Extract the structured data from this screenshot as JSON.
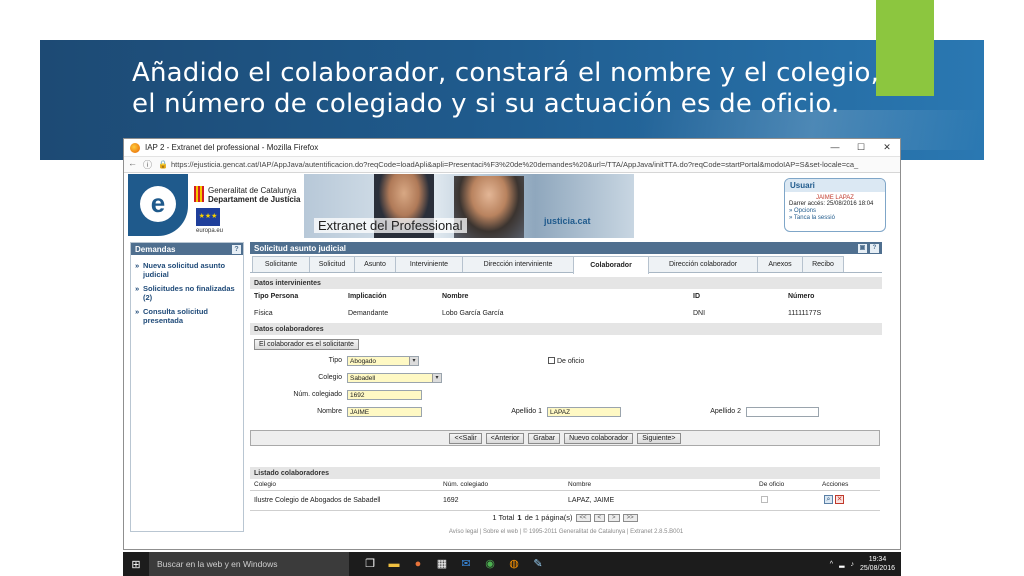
{
  "slide": {
    "title_line1": "Añadido el colaborador, constará el nombre y el colegio,",
    "title_line2": "el número de colegiado y si su actuación es de oficio.",
    "band_color": "#1f5a8c",
    "accent_color": "#8cc63f"
  },
  "browser": {
    "window_title": "IAP 2 - Extranet del professional - Mozilla Firefox",
    "url": "https://ejusticia.gencat.cat/IAP/AppJava/autentificacion.do?reqCode=loadApli&apli=Presentaci%F3%20de%20demandes%20&url=/TTA/AppJava/initTTA.do?reqCode=startPortal&modoIAP=S&set-locale=ca_",
    "controls": [
      "—",
      "☐",
      "✕"
    ]
  },
  "header": {
    "gencat_line1": "Generalitat de Catalunya",
    "gencat_line2": "Departament de Justícia",
    "eu_label": "europa.eu",
    "extranet_title": "Extranet del Professional",
    "justicia_logo": "justicia.cat",
    "user_box": {
      "title": "Usuari",
      "name": "JAIME LAPAZ",
      "last_access": "Darrer accés: 25/08/2016 18:04",
      "options": "» Opcions",
      "logout": "» Tanca la sessió"
    }
  },
  "left_panel": {
    "title": "Demandas",
    "items": [
      "Nueva solicitud asunto judicial",
      "Solicitudes no finalizadas (2)",
      "Consulta solicitud presentada"
    ]
  },
  "main": {
    "title": "Solicitud asunto judicial",
    "tabs": [
      "Solicitante",
      "Solicitud",
      "Asunto",
      "Interviniente",
      "Dirección interviniente",
      "Colaborador",
      "Dirección colaborador",
      "Anexos",
      "Recibo"
    ],
    "active_tab": "Colaborador",
    "intervinientes": {
      "section_title": "Datos intervinientes",
      "headers": [
        "Tipo Persona",
        "Implicación",
        "Nombre",
        "ID",
        "Número"
      ],
      "row": [
        "Física",
        "Demandante",
        "Lobo García García",
        "DNI",
        "11111177S"
      ]
    },
    "colaboradores": {
      "section_title": "Datos colaboradores",
      "solicitante_button": "El colaborador es el solicitante",
      "tipo_label": "Tipo",
      "tipo_value": "Abogado",
      "de_oficio_label": "De oficio",
      "colegio_label": "Colegio",
      "colegio_value": "Sabadell",
      "num_colegiado_label": "Núm. colegiado",
      "num_colegiado_value": "1692",
      "nombre_label": "Nombre",
      "nombre_value": "JAIME",
      "apellido1_label": "Apellido 1",
      "apellido1_value": "LAPAZ",
      "apellido2_label": "Apellido 2",
      "apellido2_value": ""
    },
    "buttons": {
      "salir": "<<Salir",
      "anterior": "<Anterior",
      "grabar": "Grabar",
      "nuevo": "Nuevo colaborador",
      "siguiente": "Siguiente>"
    },
    "listado": {
      "section_title": "Listado colaboradores",
      "headers": [
        "Colegio",
        "Núm. colegiado",
        "Nombre",
        "De oficio",
        "Acciones"
      ],
      "row": [
        "Ilustre Colegio de Abogados de Sabadell",
        "1692",
        "LAPAZ, JAIME"
      ]
    },
    "pager": {
      "prefix": "1 Total",
      "count": "1",
      "suffix": " de 1 página(s)",
      "first": "<<",
      "prev": "<",
      "next": ">",
      "last": ">>"
    },
    "footer": "Avíso legal  |  Sobre el web  |  © 1995-2011 Generalitat de Catalunya  |  Extranet 2.8.5.B001"
  },
  "taskbar": {
    "search_placeholder": "Buscar en la web y en Windows",
    "time": "19:34",
    "date": "25/08/2016"
  }
}
